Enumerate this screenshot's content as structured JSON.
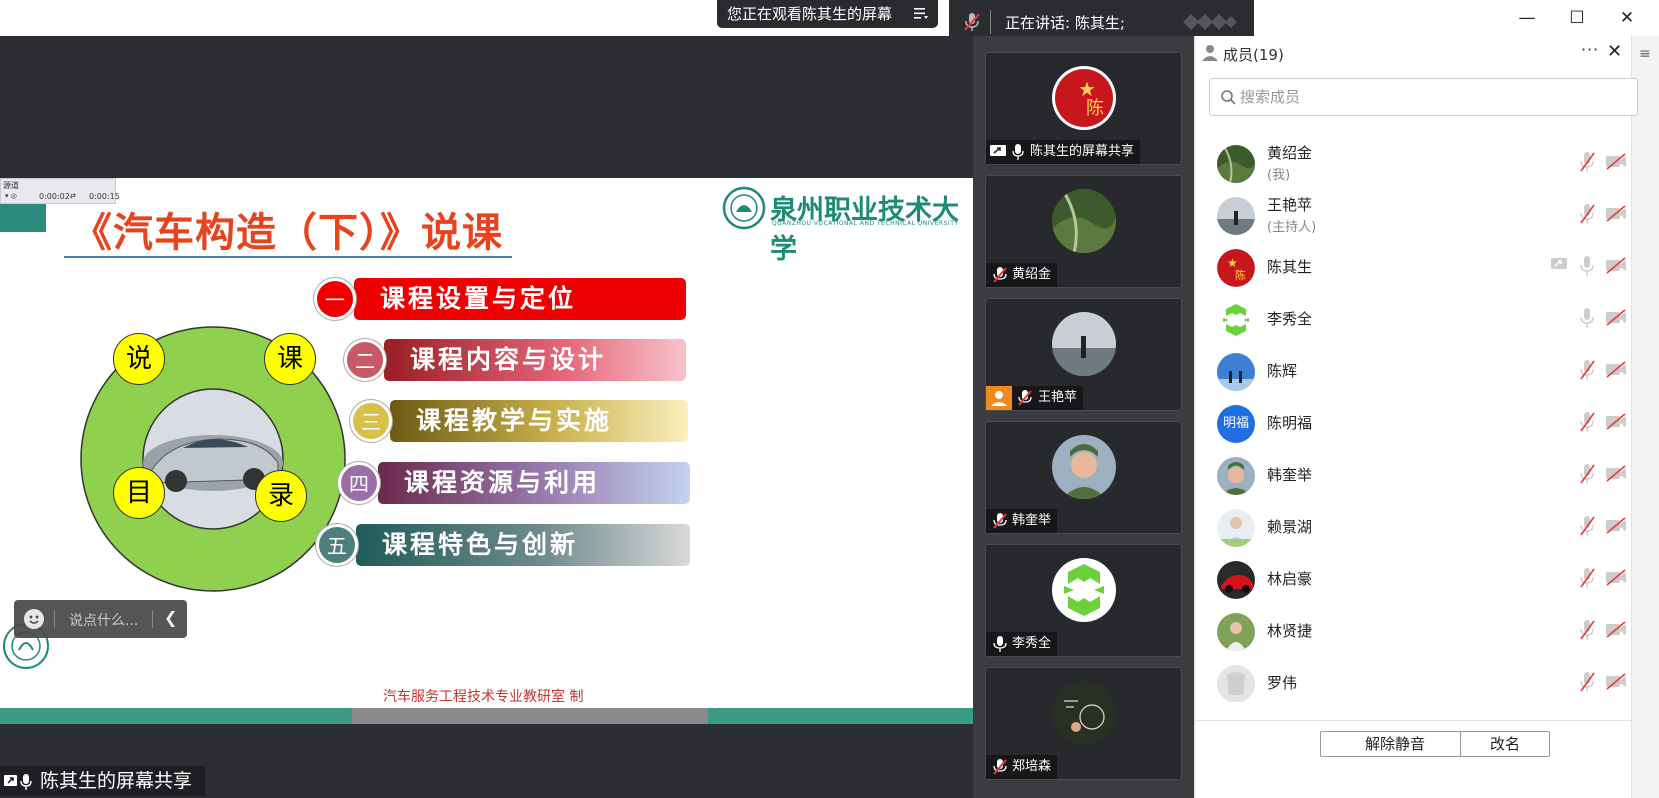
{
  "topbar": {
    "viewing_text": "您正在观看陈其生的屏幕",
    "speaking_text": "正在讲话: 陈其生;"
  },
  "slide": {
    "title": "《汽车构造（下）》说课",
    "university_name": "泉州职业技术大学",
    "university_name_en": "QUANZHOU VOCATIONAL AND TECHNICAL UNIVERSITY",
    "mini_player": {
      "label": "源道",
      "time_current": "0:00:02",
      "time_total": "0:00:15"
    },
    "circle_chars": [
      "说",
      "课",
      "目",
      "录"
    ],
    "items": [
      {
        "num": "一",
        "label": "课程设置与定位"
      },
      {
        "num": "二",
        "label": "课程内容与设计"
      },
      {
        "num": "三",
        "label": "课程教学与实施"
      },
      {
        "num": "四",
        "label": "课程资源与利用"
      },
      {
        "num": "五",
        "label": "课程特色与创新"
      }
    ],
    "footer": "汽车服务工程技术专业教研室  制"
  },
  "chat": {
    "placeholder": "说点什么..."
  },
  "share_label": "陈其生的屏幕共享",
  "tiles": [
    {
      "name": "陈其生的屏幕共享"
    },
    {
      "name": "黄绍金"
    },
    {
      "name": "王艳苹"
    },
    {
      "name": "韩奎举"
    },
    {
      "name": "李秀全"
    },
    {
      "name": "郑培森"
    }
  ],
  "members_panel": {
    "title": "成员(19)",
    "search_placeholder": "搜索成员",
    "members": [
      {
        "name": "黄绍金",
        "role": "(我)"
      },
      {
        "name": "王艳苹",
        "role": "(主持人)"
      },
      {
        "name": "陈其生",
        "role": ""
      },
      {
        "name": "李秀全",
        "role": ""
      },
      {
        "name": "陈辉",
        "role": ""
      },
      {
        "name": "陈明福",
        "role": "",
        "avatar_text": "明福"
      },
      {
        "name": "韩奎举",
        "role": ""
      },
      {
        "name": "赖景湖",
        "role": ""
      },
      {
        "name": "林启豪",
        "role": ""
      },
      {
        "name": "林贤捷",
        "role": ""
      },
      {
        "name": "罗伟",
        "role": ""
      }
    ],
    "unmute_all": "解除静音",
    "rename": "改名"
  },
  "colors": {
    "accent_teal": "#2c8b7a",
    "title_red": "#e8431d",
    "muted_red": "#e23b3b",
    "avatar_blue": "#1f6fe0"
  }
}
